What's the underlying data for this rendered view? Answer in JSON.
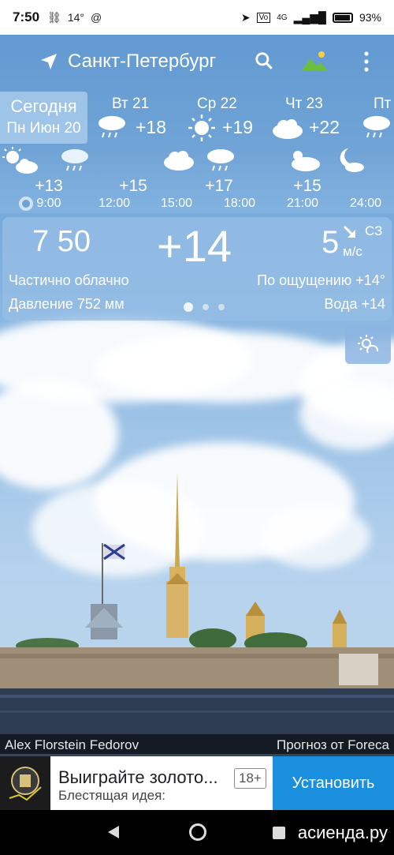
{
  "status_bar": {
    "time": "7:50",
    "temp_icon_text": "14°",
    "network": "4G",
    "battery": "93%"
  },
  "app_bar": {
    "city": "Санкт-Петербург"
  },
  "days": {
    "today_label": "Сегодня",
    "today_date": "Пн Июн 20",
    "items": [
      {
        "name": "Вт 21",
        "temp": "+18",
        "icon": "rain-icon"
      },
      {
        "name": "Ср 22",
        "temp": "+19",
        "icon": "sun-icon"
      },
      {
        "name": "Чт 23",
        "temp": "+22",
        "icon": "cloud-icon"
      },
      {
        "name": "Пт",
        "temp": "",
        "icon": "rain-icon"
      }
    ]
  },
  "hourly": [
    {
      "temp": "+13",
      "time": "9:00",
      "icon": "partly-cloudy-icon"
    },
    {
      "temp": "+15",
      "time": "12:00",
      "icon": "light-rain-icon"
    },
    {
      "temp": "",
      "time": "15:00",
      "icon": "cloud-icon"
    },
    {
      "temp": "+17",
      "time": "18:00",
      "icon": "rain-icon"
    },
    {
      "temp": "+15",
      "time": "21:00",
      "icon": "partly-cloudy-icon"
    },
    {
      "temp": "",
      "time": "24:00",
      "icon": "moon-cloud-icon"
    }
  ],
  "current": {
    "time": "7 50",
    "temp": "+14",
    "wind_speed": "5",
    "wind_dir": "СЗ",
    "wind_unit": "м/с",
    "condition": "Частично облачно",
    "feels_like": "По ощущению +14°",
    "pressure": "Давление 752 мм",
    "water": "Вода +14"
  },
  "credits": {
    "photographer": "Alex Florstein Fedorov",
    "provider": "Прогноз от Foreca"
  },
  "ad": {
    "title": "Выиграйте золото...",
    "age": "18+",
    "subtitle": "Блестящая идея:",
    "install": "Установить"
  },
  "watermark": "асиенда.ру"
}
